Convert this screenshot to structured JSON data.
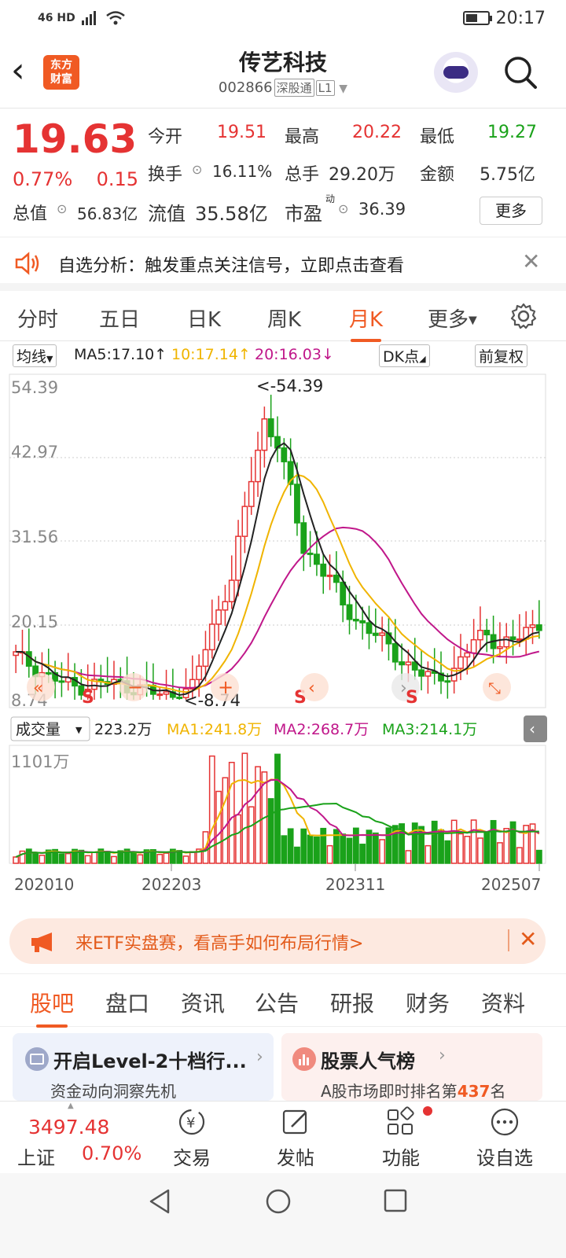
{
  "status": {
    "signal": "46 HD",
    "time": "20:17"
  },
  "header": {
    "logo_line1": "东方",
    "logo_line2": "财富",
    "title": "传艺科技",
    "code": "002866",
    "tag1": "深股通",
    "tag2": "L1"
  },
  "quote": {
    "price": "19.63",
    "pct": "0.77%",
    "change": "0.15",
    "open_label": "今开",
    "open": "19.51",
    "high_label": "最高",
    "high": "20.22",
    "low_label": "最低",
    "low": "19.27",
    "turnover_label": "换手",
    "turnover": "16.11%",
    "volume_label": "总手",
    "volume": "29.20万",
    "amount_label": "金额",
    "amount": "5.75亿",
    "mcap_label": "总值",
    "mcap": "56.83亿",
    "float_label": "流值",
    "float": "35.58亿",
    "pe_label": "市盈",
    "pe_sup": "动",
    "pe": "36.39",
    "more": "更多"
  },
  "notice": {
    "text": "自选分析：触发重点关注信号，立即点击查看"
  },
  "periods": [
    "分时",
    "五日",
    "日K",
    "周K",
    "月K",
    "更多"
  ],
  "active_period": "月K",
  "ma_bar": {
    "selector": "均线",
    "ma5": "MA5:17.10",
    "ma10": "10:17.14",
    "ma20": "20:16.03",
    "dk": "DK点",
    "adj": "前复权"
  },
  "chart_labels": {
    "y1": "54.39",
    "y2": "42.97",
    "y3": "31.56",
    "y4": "20.15",
    "y5": "8.74",
    "max_label": "<-54.39",
    "min_label": "<-8.74",
    "s": "S"
  },
  "vol_bar": {
    "selector": "成交量",
    "vol": "223.2万",
    "ma1": "MA1:241.8万",
    "ma2": "MA2:268.7万",
    "ma3": "MA3:214.1万",
    "ymax": "1101万"
  },
  "x_axis": [
    "202010",
    "202203",
    "202311",
    "202507"
  ],
  "colors": {
    "up": "#e53333",
    "down": "#1aa21a",
    "ma5": "#222222",
    "ma10": "#f0b400",
    "ma20": "#c0178a",
    "accent": "#f05a23"
  },
  "banner": {
    "text": "来ETF实盘赛，看高手如何布局行情>"
  },
  "tabs": [
    "股吧",
    "盘口",
    "资讯",
    "公告",
    "研报",
    "财务",
    "资料"
  ],
  "cards": {
    "left_title": "开启Level-2十档行...",
    "left_sub": "资金动向洞察先机",
    "right_title": "股票人气榜",
    "right_sub_prefix": "A股市场即时排名第",
    "rank": "437",
    "right_sub_suffix": "名"
  },
  "index": {
    "value": "3497.48",
    "name": "上证",
    "pct": "0.70%"
  },
  "bottom_nav": [
    "交易",
    "发帖",
    "功能",
    "设自选"
  ]
}
